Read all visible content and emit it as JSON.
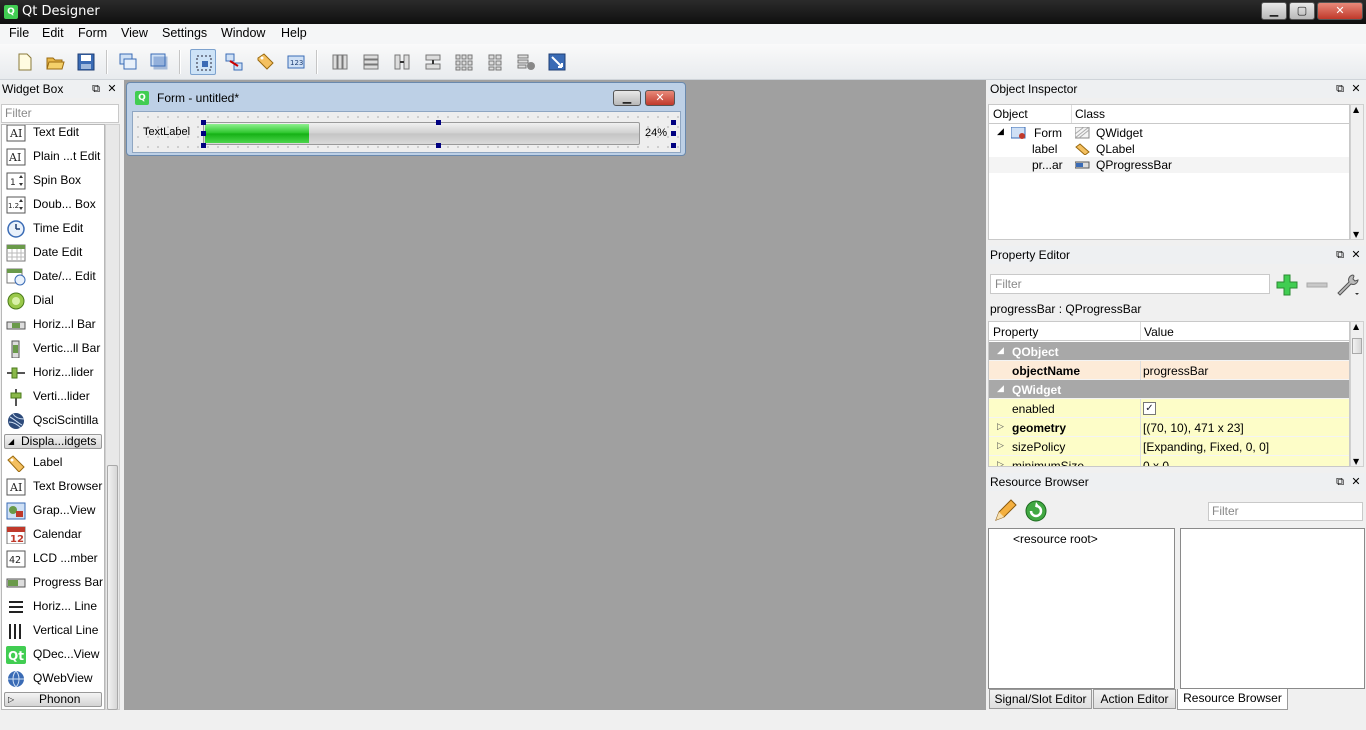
{
  "window": {
    "title": "Qt Designer",
    "minimize": "▁",
    "maximize": "▢",
    "close": "✕"
  },
  "menu": [
    "File",
    "Edit",
    "Form",
    "View",
    "Settings",
    "Window",
    "Help"
  ],
  "widget_box": {
    "title": "Widget Box",
    "filter_placeholder": "Filter",
    "float": "⧉",
    "close": "✕",
    "items": [
      {
        "label": "Text Edit",
        "icon": "text-edit-icon"
      },
      {
        "label": "Plain ...t Edit",
        "icon": "plain-text-edit-icon"
      },
      {
        "label": "Spin Box",
        "icon": "spin-box-icon"
      },
      {
        "label": "Doub... Box",
        "icon": "double-spin-box-icon"
      },
      {
        "label": "Time Edit",
        "icon": "clock-icon"
      },
      {
        "label": "Date Edit",
        "icon": "calendar-grid-icon"
      },
      {
        "label": "Date/... Edit",
        "icon": "date-time-icon"
      },
      {
        "label": "Dial",
        "icon": "dial-icon"
      },
      {
        "label": "Horiz...l Bar",
        "icon": "horizontal-scrollbar-icon"
      },
      {
        "label": "Vertic...ll Bar",
        "icon": "vertical-scrollbar-icon"
      },
      {
        "label": "Horiz...lider",
        "icon": "horizontal-slider-icon"
      },
      {
        "label": "Verti...lider",
        "icon": "vertical-slider-icon"
      },
      {
        "label": "QsciScintilla",
        "icon": "scintilla-icon"
      }
    ],
    "category_display": "Displa...idgets",
    "display_items": [
      {
        "label": "Label",
        "icon": "label-tag-icon"
      },
      {
        "label": "Text Browser",
        "icon": "text-browser-icon"
      },
      {
        "label": "Grap...View",
        "icon": "graphics-view-icon"
      },
      {
        "label": "Calendar",
        "icon": "calendar-icon",
        "badge": "12"
      },
      {
        "label": "LCD ...mber",
        "icon": "lcd-number-icon",
        "badge": "42"
      },
      {
        "label": "Progress Bar",
        "icon": "progress-bar-icon"
      },
      {
        "label": "Horiz... Line",
        "icon": "horizontal-line-icon"
      },
      {
        "label": "Vertical Line",
        "icon": "vertical-line-icon"
      },
      {
        "label": "QDec...View",
        "icon": "qt-logo-icon",
        "badge": "Qt"
      },
      {
        "label": "QWebView",
        "icon": "globe-icon"
      }
    ],
    "category_phonon": "Phonon"
  },
  "form": {
    "title": "Form - untitled*",
    "label_text": "TextLabel",
    "progress_value": 24,
    "progress_text": "24%",
    "minimize": "▁",
    "close": "✕"
  },
  "object_inspector": {
    "title": "Object Inspector",
    "col_object": "Object",
    "col_class": "Class",
    "rows": [
      {
        "object": "Form",
        "class": "QWidget"
      },
      {
        "object": "label",
        "class": "QLabel"
      },
      {
        "object": "pr...ar",
        "class": "QProgressBar"
      }
    ]
  },
  "property_editor": {
    "title": "Property Editor",
    "filter_placeholder": "Filter",
    "object_name_line": "progressBar : QProgressBar",
    "col_property": "Property",
    "col_value": "Value",
    "rows": [
      {
        "name": "QObject",
        "value": "",
        "kind": "group"
      },
      {
        "name": "objectName",
        "value": "progressBar",
        "kind": "highlight"
      },
      {
        "name": "QWidget",
        "value": "",
        "kind": "group"
      },
      {
        "name": "enabled",
        "value": "✓",
        "kind": "checkbox"
      },
      {
        "name": "geometry",
        "value": "[(70, 10), 471 x 23]",
        "kind": "bold-expand"
      },
      {
        "name": "sizePolicy",
        "value": "[Expanding, Fixed, 0, 0]",
        "kind": "expand"
      },
      {
        "name": "minimumSize",
        "value": "0 x 0",
        "kind": "expand"
      }
    ]
  },
  "resource_browser": {
    "title": "Resource Browser",
    "filter_placeholder": "Filter",
    "root": "<resource root>"
  },
  "bottom_tabs": [
    "Signal/Slot Editor",
    "Action Editor",
    "Resource Browser"
  ],
  "colors": {
    "progress_green": "#27c427",
    "group_gray": "#a8a8a8",
    "selection_handle": "#000080"
  }
}
